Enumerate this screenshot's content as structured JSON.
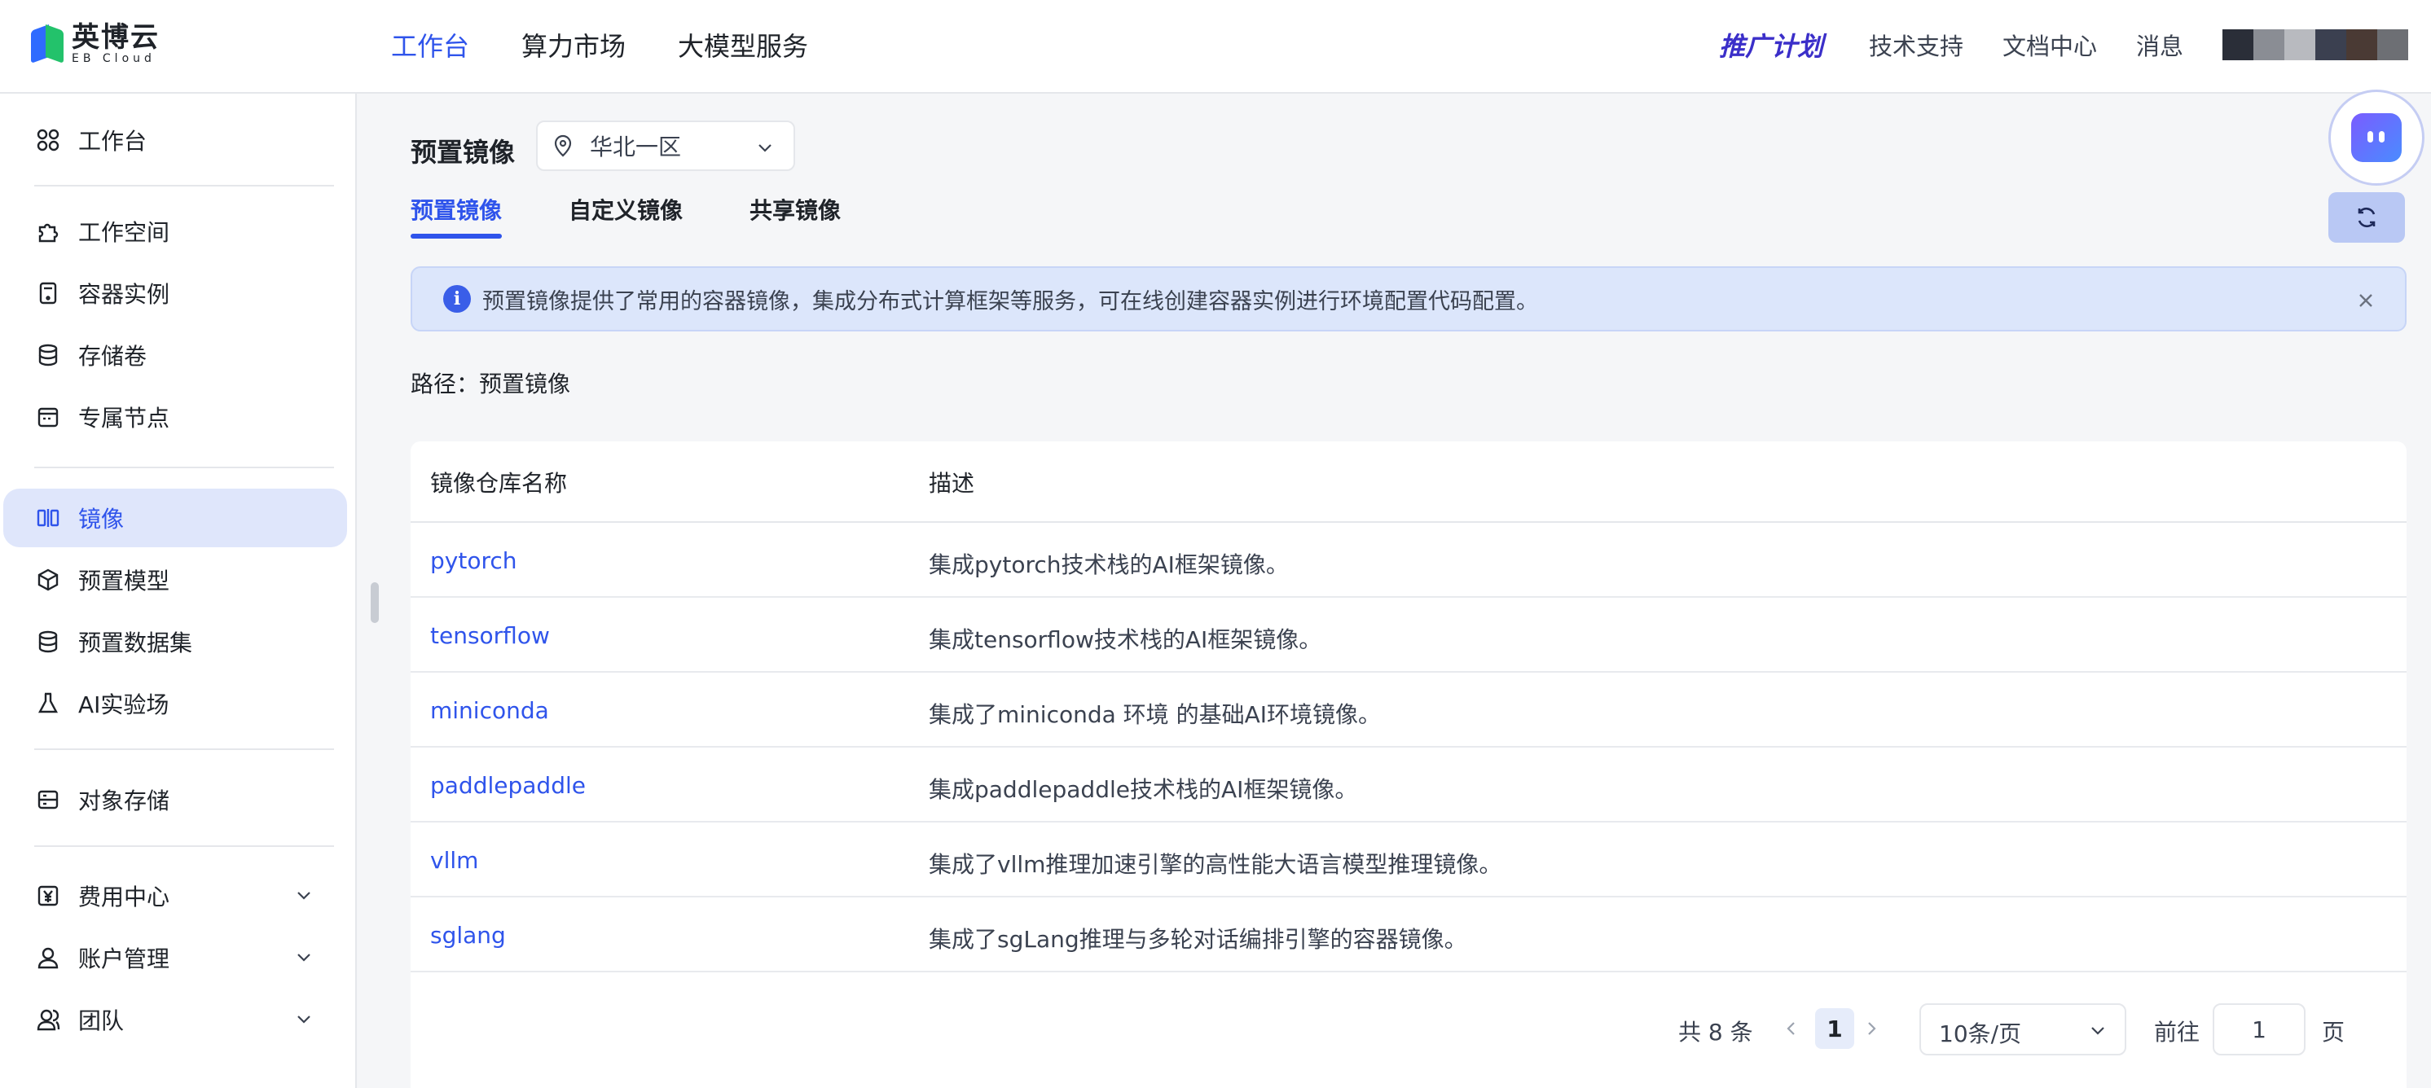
{
  "brand": {
    "name_cn": "英博云",
    "name_en": "EB Cloud"
  },
  "topnav": [
    {
      "label": "工作台",
      "active": true
    },
    {
      "label": "算力市场",
      "active": false
    },
    {
      "label": "大模型服务",
      "active": false
    }
  ],
  "header_right": {
    "promo": "推广计划",
    "support": "技术支持",
    "docs": "文档中心",
    "messages": "消息"
  },
  "sidebar": {
    "workbench": "工作台",
    "workspace": "工作空间",
    "container": "容器实例",
    "storage": "存储卷",
    "node": "专属节点",
    "image": "镜像",
    "model": "预置模型",
    "dataset": "预置数据集",
    "ailab": "AI实验场",
    "object_storage": "对象存储",
    "billing": "费用中心",
    "account": "账户管理",
    "team": "团队"
  },
  "main": {
    "title": "预置镜像",
    "region": "华北一区",
    "tabs": [
      {
        "label": "预置镜像",
        "active": true
      },
      {
        "label": "自定义镜像",
        "active": false
      },
      {
        "label": "共享镜像",
        "active": false
      }
    ],
    "alert": "预置镜像提供了常用的容器镜像，集成分布式计算框架等服务，可在线创建容器实例进行环境配置代码配置。",
    "path": "路径：预置镜像"
  },
  "table": {
    "columns": [
      "镜像仓库名称",
      "描述"
    ],
    "rows": [
      {
        "name": "pytorch",
        "desc": "集成pytorch技术栈的AI框架镜像。"
      },
      {
        "name": "tensorflow",
        "desc": "集成tensorflow技术栈的AI框架镜像。"
      },
      {
        "name": "miniconda",
        "desc": "集成了miniconda 环境 的基础AI环境镜像。"
      },
      {
        "name": "paddlepaddle",
        "desc": "集成paddlepaddle技术栈的AI框架镜像。"
      },
      {
        "name": "vllm",
        "desc": "集成了vllm推理加速引擎的高性能大语言模型推理镜像。"
      },
      {
        "name": "sglang",
        "desc": "集成了sgLang推理与多轮对话编排引擎的容器镜像。"
      }
    ]
  },
  "pagination": {
    "total": "共 8 条",
    "current": "1",
    "page_size": "10条/页",
    "goto_label": "前往",
    "goto_value": "1",
    "page_unit": "页"
  },
  "colors": {
    "accent": "#2f54eb",
    "active_bg": "#dfe6fb",
    "alert_bg": "#dce6fb"
  }
}
